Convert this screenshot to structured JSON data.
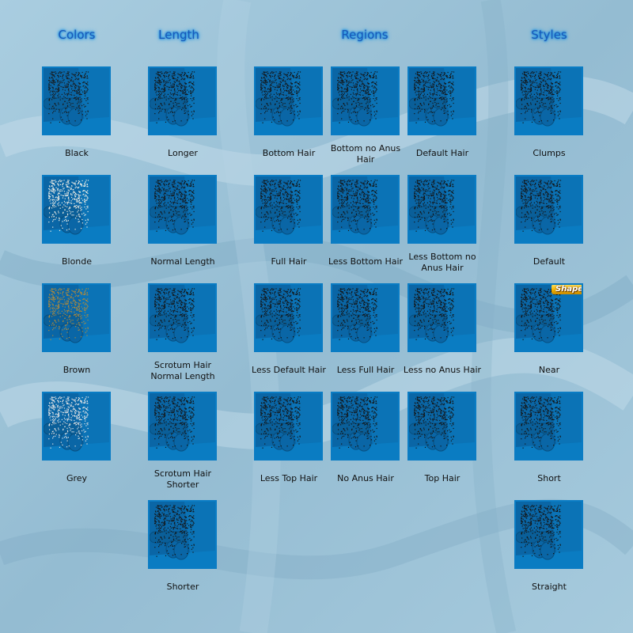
{
  "headers": {
    "colors": "Colors",
    "length": "Length",
    "regions": "Regions",
    "styles": "Styles"
  },
  "colors": {
    "items": [
      {
        "label": "Black",
        "hair": "#1a1a1a"
      },
      {
        "label": "Blonde",
        "hair": "#f2f0e6"
      },
      {
        "label": "Brown",
        "hair": "#b08a3a"
      },
      {
        "label": "Grey",
        "hair": "#e6e6e6"
      }
    ]
  },
  "length": {
    "items": [
      {
        "label_lines": [
          "Longer"
        ]
      },
      {
        "label_lines": [
          "Normal Length"
        ]
      },
      {
        "label_lines": [
          "Scrotum Hair",
          "Normal Length"
        ]
      },
      {
        "label_lines": [
          "Scrotum Hair",
          "Shorter"
        ]
      },
      {
        "label_lines": [
          "Shorter"
        ]
      }
    ]
  },
  "regions": {
    "items": [
      {
        "label_lines": [
          "Bottom Hair"
        ]
      },
      {
        "label_lines": [
          "Bottom no Anus",
          "Hair"
        ]
      },
      {
        "label_lines": [
          "Default Hair"
        ]
      },
      {
        "label_lines": [
          "Full Hair"
        ]
      },
      {
        "label_lines": [
          "Less Bottom Hair"
        ]
      },
      {
        "label_lines": [
          "Less Bottom no",
          "Anus Hair"
        ]
      },
      {
        "label_lines": [
          "Less Default Hair"
        ]
      },
      {
        "label_lines": [
          "Less Full Hair"
        ]
      },
      {
        "label_lines": [
          "Less no Anus Hair"
        ]
      },
      {
        "label_lines": [
          "Less Top Hair"
        ]
      },
      {
        "label_lines": [
          "No Anus Hair"
        ]
      },
      {
        "label_lines": [
          "Top Hair"
        ]
      }
    ]
  },
  "styles": {
    "items": [
      {
        "label": "Clumps"
      },
      {
        "label": "Default"
      },
      {
        "label": "Near",
        "badge": "Shape"
      },
      {
        "label": "Short"
      },
      {
        "label": "Straight"
      }
    ]
  },
  "colors_theme": {
    "thumb_bg": "#0a6fb0",
    "accent": "#1a9be8",
    "badge": "#f5b300"
  }
}
